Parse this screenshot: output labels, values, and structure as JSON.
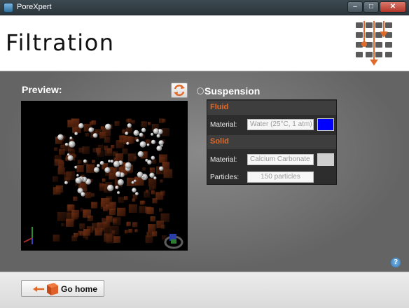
{
  "window": {
    "title": "PoreXpert",
    "buttons": {
      "minimize": "–",
      "maximize": "□",
      "close": "✕"
    }
  },
  "header": {
    "title": "Filtration"
  },
  "preview": {
    "label": "Preview:"
  },
  "suspension": {
    "label": "Suspension",
    "fluid": {
      "header": "Fluid",
      "material_label": "Material:",
      "material_value": "Water (25°C, 1 atm)",
      "color": "#0000ff"
    },
    "solid": {
      "header": "Solid",
      "material_label": "Material:",
      "material_value": "Calcium Carbonate",
      "color": "#cfcfcf",
      "particles_label": "Particles:",
      "particles_value": "150 particles"
    }
  },
  "help": {
    "label": "?"
  },
  "footer": {
    "home_label": "Go home"
  },
  "colors": {
    "accent": "#e06a2c",
    "panel": "#2d2d2d",
    "logo_grey": "#5a5a5a"
  }
}
